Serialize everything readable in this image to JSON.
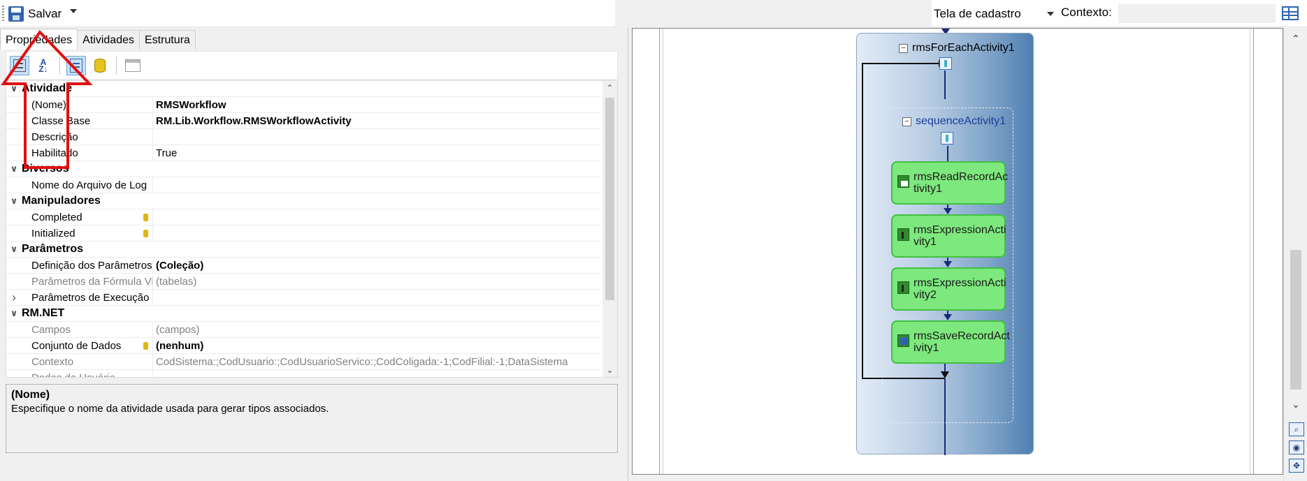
{
  "toolbar": {
    "save_label": "Salvar",
    "screen_select_value": "Tela de cadastro",
    "context_label": "Contexto:",
    "context_value": ""
  },
  "tabs": [
    {
      "label": "Propriedades",
      "active": true
    },
    {
      "label": "Atividades",
      "active": false
    },
    {
      "label": "Estrutura",
      "active": false
    }
  ],
  "property_toolbar": {
    "categorized_icon": "categorized-icon",
    "alphabetical_icon": "sort-az-icon",
    "properties_icon": "properties-icon",
    "events_icon": "events-icon",
    "property_pages_icon": "property-pages-icon"
  },
  "properties": {
    "cat_atividade": "Atividade",
    "nome_label": "(Nome)",
    "nome_value": "RMSWorkflow",
    "classe_label": "Classe Base",
    "classe_value": "RM.Lib.Workflow.RMSWorkflowActivity",
    "descricao_label": "Descrição",
    "descricao_value": "",
    "habilitado_label": "Habilitado",
    "habilitado_value": "True",
    "cat_diversos": "Diversos",
    "log_label": "Nome do Arquivo de Log",
    "log_value": "",
    "cat_manipuladores": "Manipuladores",
    "completed_label": "Completed",
    "completed_value": "",
    "initialized_label": "Initialized",
    "initialized_value": "",
    "cat_parametros": "Parâmetros",
    "defparam_label": "Definição dos Parâmetros d",
    "defparam_value": "(Coleção)",
    "paramformula_label": "Parâmetros da Fórmula Vis",
    "paramformula_value": "(tabelas)",
    "paramexec_label": "Parâmetros de Execução",
    "paramexec_value": "",
    "cat_rmnet": "RM.NET",
    "campos_label": "Campos",
    "campos_value": "(campos)",
    "conjunto_label": "Conjunto de Dados",
    "conjunto_value": "(nenhum)",
    "contexto_label": "Contexto",
    "contexto_value": "CodSistema:;CodUsuario:;CodUsuarioServico:;CodColigada:-1;CodFilial:-1;DataSistema",
    "dadosusuario_label": "Dados do Usuário",
    "dadosusuario_value": ""
  },
  "description": {
    "title": "(Nome)",
    "text": "Especifique o nome da atividade usada para gerar tipos associados."
  },
  "designer": {
    "foreach_title": "rmsForEachActivity1",
    "sequence_title": "sequenceActivity1",
    "nodes": [
      {
        "line1": "rmsReadRecordAc",
        "line2": "tivity1"
      },
      {
        "line1": "rmsExpressionActi",
        "line2": "vity1"
      },
      {
        "line1": "rmsExpressionActi",
        "line2": "vity2"
      },
      {
        "line1": "rmsSaveRecordAct",
        "line2": "ivity1"
      }
    ]
  },
  "colors": {
    "annotation_arrow": "#e01010",
    "activity_green": "#7de87d",
    "foreach_blue": "#4f7fb1"
  }
}
